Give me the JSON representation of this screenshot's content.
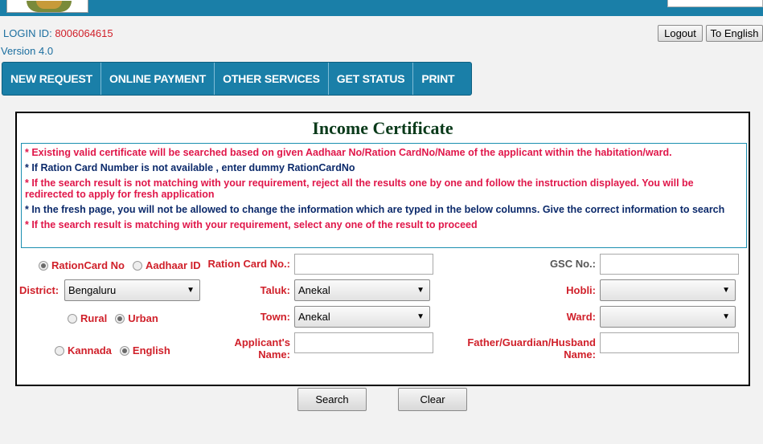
{
  "header": {
    "login_label": "LOGIN ID:",
    "login_id": "8006064615",
    "version": "Version 4.0",
    "logout_label": "Logout",
    "language_label": "To English"
  },
  "menu": {
    "items": [
      {
        "label": "NEW REQUEST"
      },
      {
        "label": "ONLINE PAYMENT"
      },
      {
        "label": "OTHER SERVICES"
      },
      {
        "label": "GET STATUS"
      },
      {
        "label": "PRINT"
      }
    ]
  },
  "form": {
    "title": "Income Certificate",
    "notes": [
      {
        "text": "* Existing valid certificate will be searched based on given Aadhaar No/Ration CardNo/Name of the applicant within the habitation/ward.",
        "color": "red"
      },
      {
        "text": "* If Ration Card Number is not available , enter dummy RationCardNo",
        "color": "blue"
      },
      {
        "text": "* If the search result is not matching with your requirement, reject all the results one by one and follow the instruction displayed. You will be redirected to apply for fresh application",
        "color": "red"
      },
      {
        "text": "* In the fresh page, you will not be allowed to change the information which are typed in the below columns. Give the correct information to search",
        "color": "blue"
      },
      {
        "text": "* If the search result is matching with your requirement, select any one of the result to proceed",
        "color": "red"
      }
    ],
    "id_type": {
      "ration_label": "RationCard No",
      "aadhaar_label": "Aadhaar ID",
      "selected": "RationCard No"
    },
    "area_type": {
      "rural_label": "Rural",
      "urban_label": "Urban",
      "selected": "Urban"
    },
    "language": {
      "kannada_label": "Kannada",
      "english_label": "English",
      "selected": "English"
    },
    "ration_card_label": "Ration Card No.:",
    "ration_card_value": "",
    "gsc_label": "GSC No.:",
    "gsc_value": "",
    "district_label": "District:",
    "district_value": "Bengaluru",
    "taluk_label": "Taluk:",
    "taluk_value": "Anekal",
    "hobli_label": "Hobli:",
    "hobli_value": "",
    "town_label": "Town:",
    "town_value": "Anekal",
    "ward_label": "Ward:",
    "ward_value": "",
    "applicant_label_1": "Applicant's",
    "applicant_label_2": "Name:",
    "applicant_value": "",
    "father_label_1": "Father/Guardian/Husband",
    "father_label_2": "Name:",
    "father_value": ""
  },
  "actions": {
    "search_label": "Search",
    "clear_label": "Clear"
  },
  "colors": {
    "header_blue": "#1a7fa8",
    "label_red": "#d0202a",
    "note_red": "#e0174a",
    "note_blue": "#0c2a6b",
    "title_green": "#0a3a1a"
  }
}
